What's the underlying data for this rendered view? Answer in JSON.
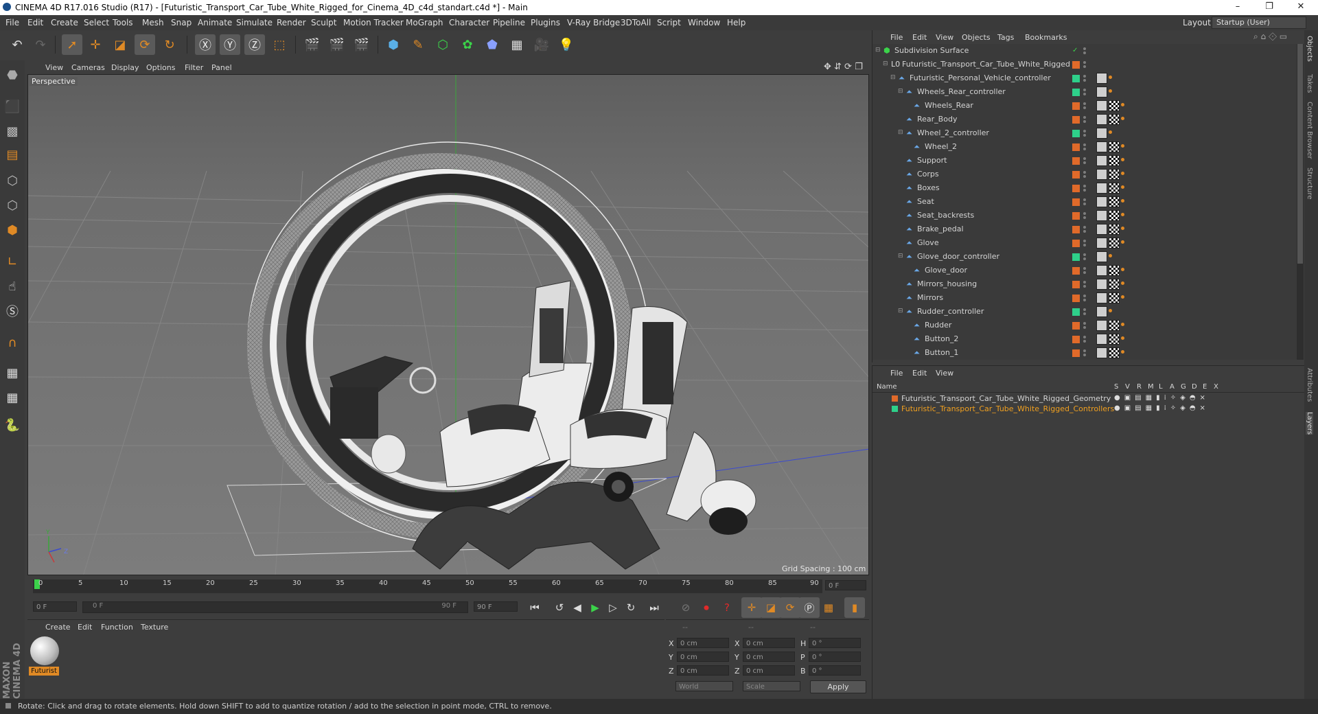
{
  "window": {
    "title": "CINEMA 4D R17.016 Studio (R17) - [Futuristic_Transport_Car_Tube_White_Rigged_for_Cinema_4D_c4d_standart.c4d *] - Main",
    "minimize": "–",
    "restore": "❐",
    "close": "✕"
  },
  "menubar": {
    "items": [
      "File",
      "Edit",
      "Create",
      "Select",
      "Tools",
      "Mesh",
      "Snap",
      "Animate",
      "Simulate",
      "Render",
      "Sculpt",
      "Motion Tracker",
      "MoGraph",
      "Character",
      "Pipeline",
      "Plugins",
      "V-Ray Bridge",
      "3DToAll",
      "Script",
      "Window",
      "Help"
    ],
    "layout_label": "Layout:",
    "layout_value": "Startup (User)"
  },
  "viewport": {
    "menu": [
      "View",
      "Cameras",
      "Display",
      "Options",
      "Filter",
      "Panel"
    ],
    "label": "Perspective",
    "grid_spacing": "Grid Spacing : 100 cm",
    "axis_y": "Y",
    "axis_z": "Z"
  },
  "timeline": {
    "ticks": [
      "0",
      "5",
      "10",
      "15",
      "20",
      "25",
      "30",
      "35",
      "40",
      "45",
      "50",
      "55",
      "60",
      "65",
      "70",
      "75",
      "80",
      "85",
      "90"
    ],
    "current": "0 F"
  },
  "transport": {
    "start_field": "0 F",
    "range_start": "0 F",
    "range_end": "90 F",
    "end_field": "90 F"
  },
  "material_manager": {
    "menu": [
      "Create",
      "Edit",
      "Function",
      "Texture"
    ],
    "material_name": "Futurist"
  },
  "coordinates": {
    "headers": [
      "--",
      "--",
      "--"
    ],
    "rows": [
      {
        "a": "X",
        "av": "0 cm",
        "b": "X",
        "bv": "0 cm",
        "c": "H",
        "cv": "0 °"
      },
      {
        "a": "Y",
        "av": "0 cm",
        "b": "Y",
        "bv": "0 cm",
        "c": "P",
        "cv": "0 °"
      },
      {
        "a": "Z",
        "av": "0 cm",
        "b": "Z",
        "bv": "0 cm",
        "c": "B",
        "cv": "0 °"
      }
    ],
    "mode1": "World",
    "mode2": "Scale",
    "apply": "Apply"
  },
  "object_manager": {
    "menu": [
      "File",
      "Edit",
      "View",
      "Objects",
      "Tags",
      "Bookmarks"
    ],
    "objects": [
      {
        "name": "Subdivision Surface",
        "level": 0,
        "layer": "",
        "tags": 0
      },
      {
        "name": "Futuristic_Transport_Car_Tube_White_Rigged",
        "level": 1,
        "layer": "#e06a2a",
        "tags": 0
      },
      {
        "name": "Futuristic_Personal_Vehicle_controller",
        "level": 2,
        "layer": "#2ed08a",
        "tags": 1
      },
      {
        "name": "Wheels_Rear_controller",
        "level": 3,
        "layer": "#2ed08a",
        "tags": 1
      },
      {
        "name": "Wheels_Rear",
        "level": 4,
        "layer": "#e06a2a",
        "tags": 2
      },
      {
        "name": "Rear_Body",
        "level": 3,
        "layer": "#e06a2a",
        "tags": 2
      },
      {
        "name": "Wheel_2_controller",
        "level": 3,
        "layer": "#2ed08a",
        "tags": 1
      },
      {
        "name": "Wheel_2",
        "level": 4,
        "layer": "#e06a2a",
        "tags": 2
      },
      {
        "name": "Support",
        "level": 3,
        "layer": "#e06a2a",
        "tags": 2
      },
      {
        "name": "Corps",
        "level": 3,
        "layer": "#e06a2a",
        "tags": 2
      },
      {
        "name": "Boxes",
        "level": 3,
        "layer": "#e06a2a",
        "tags": 2
      },
      {
        "name": "Seat",
        "level": 3,
        "layer": "#e06a2a",
        "tags": 2
      },
      {
        "name": "Seat_backrests",
        "level": 3,
        "layer": "#e06a2a",
        "tags": 2
      },
      {
        "name": "Brake_pedal",
        "level": 3,
        "layer": "#e06a2a",
        "tags": 2
      },
      {
        "name": "Glove",
        "level": 3,
        "layer": "#e06a2a",
        "tags": 2
      },
      {
        "name": "Glove_door_controller",
        "level": 3,
        "layer": "#2ed08a",
        "tags": 1
      },
      {
        "name": "Glove_door",
        "level": 4,
        "layer": "#e06a2a",
        "tags": 2
      },
      {
        "name": "Mirrors_housing",
        "level": 3,
        "layer": "#e06a2a",
        "tags": 2
      },
      {
        "name": "Mirrors",
        "level": 3,
        "layer": "#e06a2a",
        "tags": 2
      },
      {
        "name": "Rudder_controller",
        "level": 3,
        "layer": "#2ed08a",
        "tags": 1
      },
      {
        "name": "Rudder",
        "level": 4,
        "layer": "#e06a2a",
        "tags": 2
      },
      {
        "name": "Button_2",
        "level": 4,
        "layer": "#e06a2a",
        "tags": 2
      },
      {
        "name": "Button_1",
        "level": 4,
        "layer": "#e06a2a",
        "tags": 2
      }
    ]
  },
  "layer_manager": {
    "menu": [
      "File",
      "Edit",
      "View"
    ],
    "name_header": "Name",
    "columns": [
      "S",
      "V",
      "R",
      "M",
      "L",
      "A",
      "G",
      "D",
      "E",
      "X"
    ],
    "layers": [
      {
        "name": "Futuristic_Transport_Car_Tube_White_Rigged_Geometry",
        "color": "#e06a2a",
        "text_color": "#d4d4d4"
      },
      {
        "name": "Futuristic_Transport_Car_Tube_White_Rigged_Controllers",
        "color": "#2ed08a",
        "text_color": "#f0a020"
      }
    ]
  },
  "right_tabs": [
    "Objects",
    "Takes",
    "Content Browser",
    "Structure",
    "Attributes",
    "Layers"
  ],
  "brand": "MAXON CINEMA 4D",
  "status": "Rotate: Click and drag to rotate elements. Hold down SHIFT to add to quantize rotation / add to the selection in point mode, CTRL to remove.",
  "colors": {
    "accent_orange": "#e08a25",
    "selection_green": "#2ed08a",
    "play_green": "#3bd34a"
  }
}
